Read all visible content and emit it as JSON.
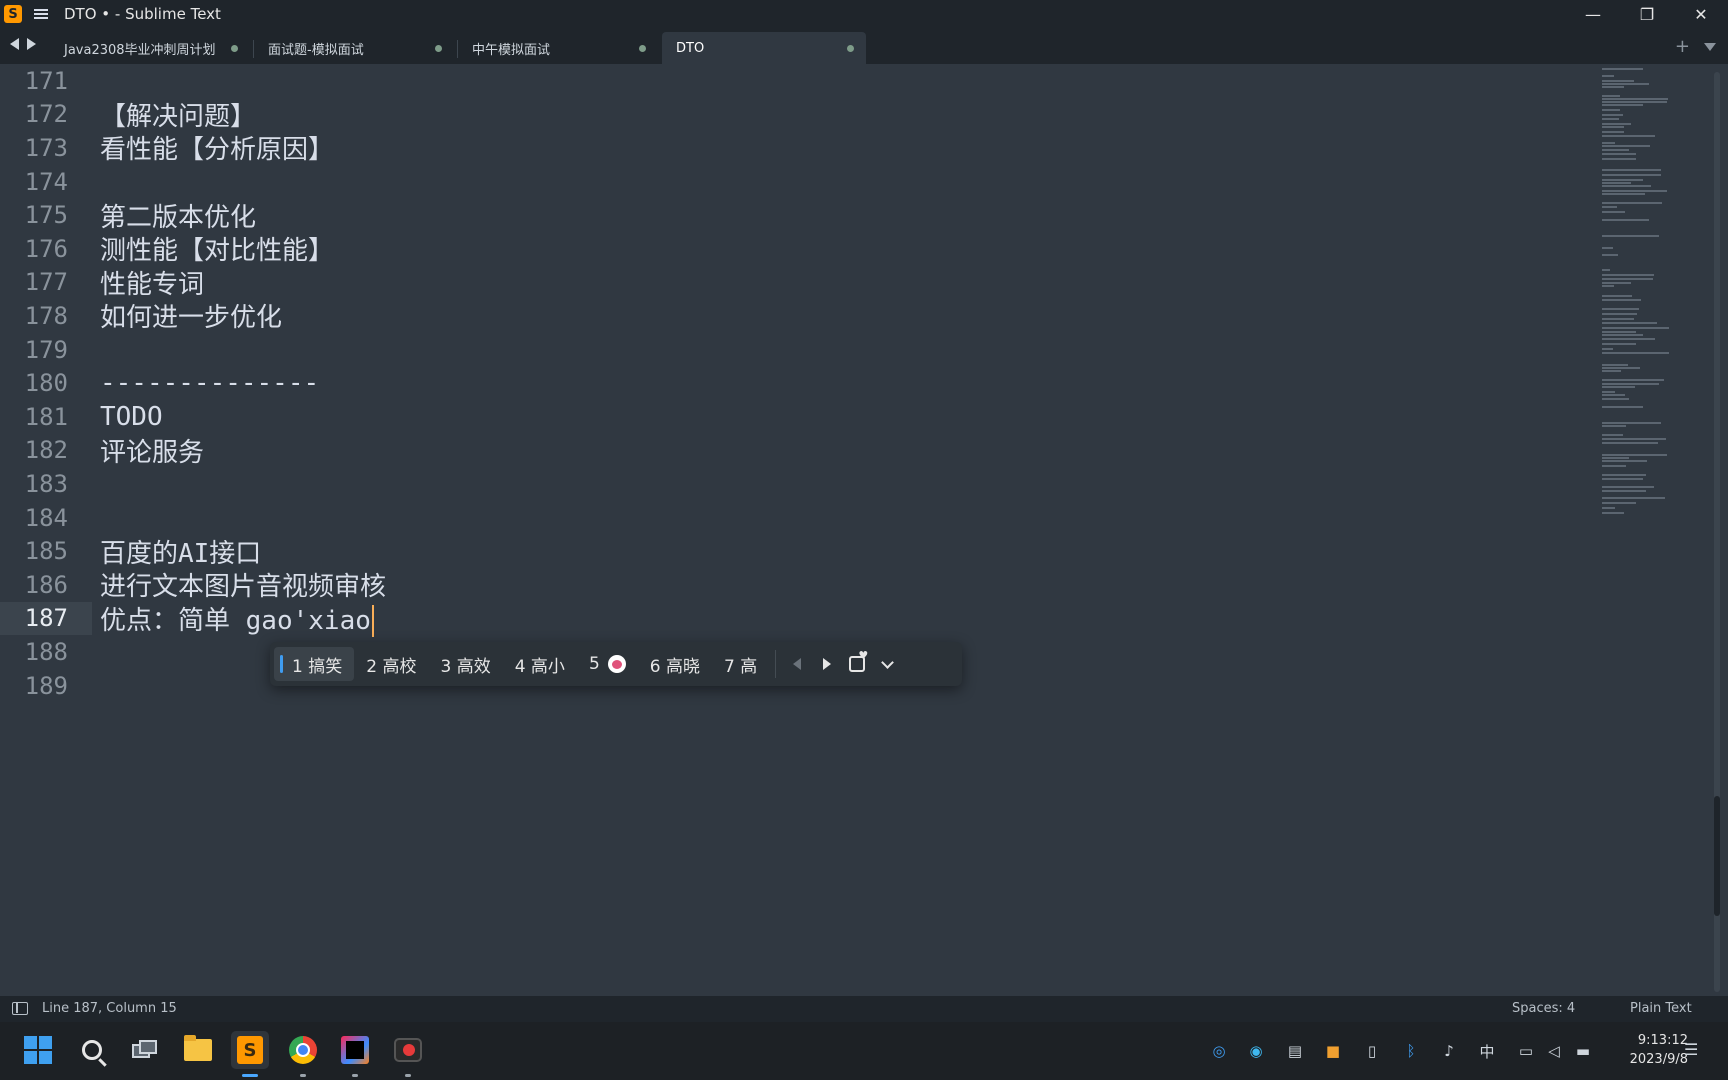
{
  "window": {
    "title": "DTO • - Sublime Text",
    "controls": {
      "minimize": "—",
      "restore": "❐",
      "close": "✕"
    }
  },
  "tabs": [
    {
      "label": "Java2308毕业冲刺周计划",
      "modified": true,
      "active": false
    },
    {
      "label": "面试题-模拟面试",
      "modified": true,
      "active": false
    },
    {
      "label": "中午模拟面试",
      "modified": true,
      "active": false
    },
    {
      "label": "DTO",
      "modified": true,
      "active": true
    }
  ],
  "tab_actions": {
    "new_tab": "+"
  },
  "editor": {
    "lines": [
      {
        "number": "171",
        "text": ""
      },
      {
        "number": "172",
        "text": "【解决问题】"
      },
      {
        "number": "173",
        "text": "看性能【分析原因】"
      },
      {
        "number": "174",
        "text": ""
      },
      {
        "number": "175",
        "text": "第二版本优化"
      },
      {
        "number": "176",
        "text": "测性能【对比性能】"
      },
      {
        "number": "177",
        "text": "性能专词"
      },
      {
        "number": "178",
        "text": "如何进一步优化"
      },
      {
        "number": "179",
        "text": ""
      },
      {
        "number": "180",
        "text": "--------------"
      },
      {
        "number": "181",
        "text": "TODO"
      },
      {
        "number": "182",
        "text": "评论服务"
      },
      {
        "number": "183",
        "text": ""
      },
      {
        "number": "184",
        "text": ""
      },
      {
        "number": "185",
        "text": "百度的AI接口"
      },
      {
        "number": "186",
        "text": "进行文本图片音视频审核"
      },
      {
        "number": "187",
        "text": "优点：简单 gao'xiao",
        "current": true
      },
      {
        "number": "188",
        "text": ""
      },
      {
        "number": "189",
        "text": ""
      }
    ],
    "cursor_color": "#f9ae58"
  },
  "ime": {
    "candidates": [
      {
        "label": "1 搞笑",
        "selected": true
      },
      {
        "label": "2 高校"
      },
      {
        "label": "3 高效"
      },
      {
        "label": "4 高小"
      },
      {
        "label": "5",
        "emoji": "clown-face-emoji"
      },
      {
        "label": "6 高晓"
      },
      {
        "label": "7 高"
      }
    ],
    "controls": [
      "prev-page-icon",
      "next-page-icon",
      "favorite-icon",
      "expand-chevron-icon"
    ]
  },
  "statusbar": {
    "position": "Line 187, Column 15",
    "indentation": "Spaces: 4",
    "syntax": "Plain Text"
  },
  "taskbar": {
    "apps": [
      "start-button",
      "search-icon",
      "task-view-icon",
      "file-explorer-icon",
      "sublime-text-icon",
      "chrome-icon",
      "intellij-idea-icon",
      "screen-recorder-icon"
    ],
    "tray": {
      "ime_mode": "中",
      "time": "9:13:12",
      "date": "2023/9/8"
    }
  },
  "colors": {
    "editor_bg": "#303841",
    "chrome_bg": "#1f252b",
    "text": "#d8dee9",
    "gutter_text": "#8a939c",
    "accent": "#3f9cf0"
  }
}
